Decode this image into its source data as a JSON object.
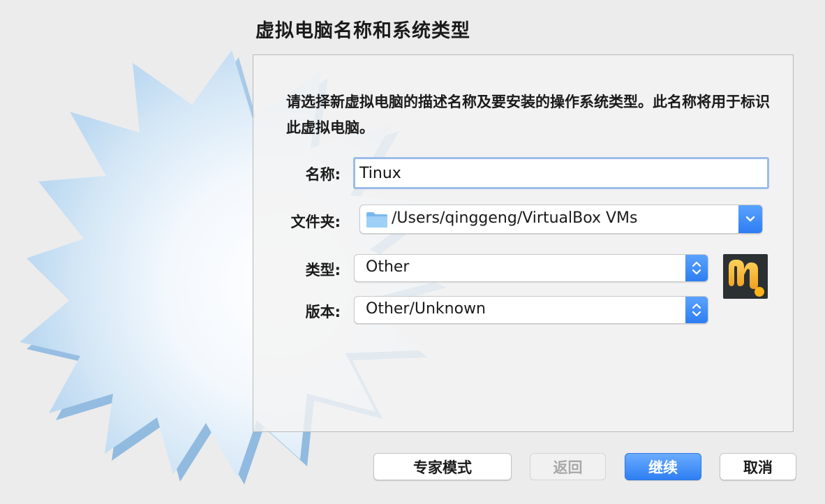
{
  "page": {
    "title": "虚拟电脑名称和系统类型",
    "description": "请选择新虚拟电脑的描述名称及要安装的操作系统类型。此名称将用于标识此虚拟电脑。"
  },
  "form": {
    "name": {
      "label": "名称:",
      "value": "Tinux"
    },
    "folder": {
      "label": "文件夹:",
      "value": "/Users/qinggeng/VirtualBox VMs",
      "icon": "folder-icon"
    },
    "type": {
      "label": "类型:",
      "value": "Other"
    },
    "version": {
      "label": "版本:",
      "value": "Other/Unknown"
    },
    "os_icon": "other-os-icon"
  },
  "buttons": {
    "expert": "专家模式",
    "back": "返回",
    "continue": "继续",
    "cancel": "取消"
  },
  "colors": {
    "accent": "#2f7ff3",
    "panel_border": "#b9b9b9",
    "background": "#ececec"
  }
}
